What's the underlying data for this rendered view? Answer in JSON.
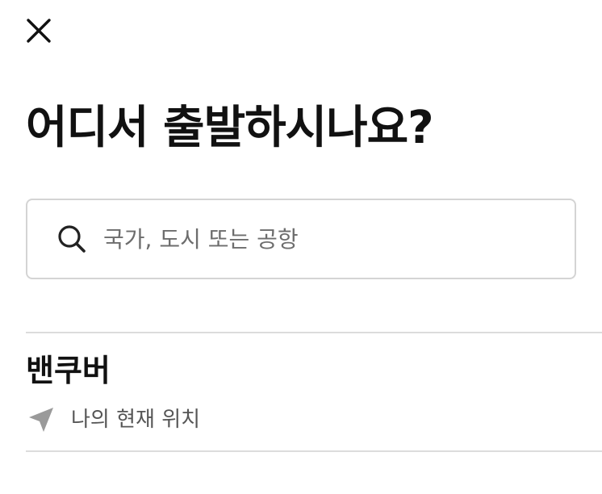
{
  "header": {
    "close_icon": "close-icon",
    "title": "어디서 출발하시나요?"
  },
  "search": {
    "icon": "search-icon",
    "placeholder": "국가, 도시 또는 공항",
    "value": ""
  },
  "results": [
    {
      "name": "밴쿠버",
      "icon": "navigation-arrow-icon",
      "subtitle": "나의 현재 위치"
    }
  ],
  "colors": {
    "text": "#111111",
    "muted": "#555555",
    "border": "#d4d4d4",
    "icon_gray": "#9a9a9a"
  }
}
